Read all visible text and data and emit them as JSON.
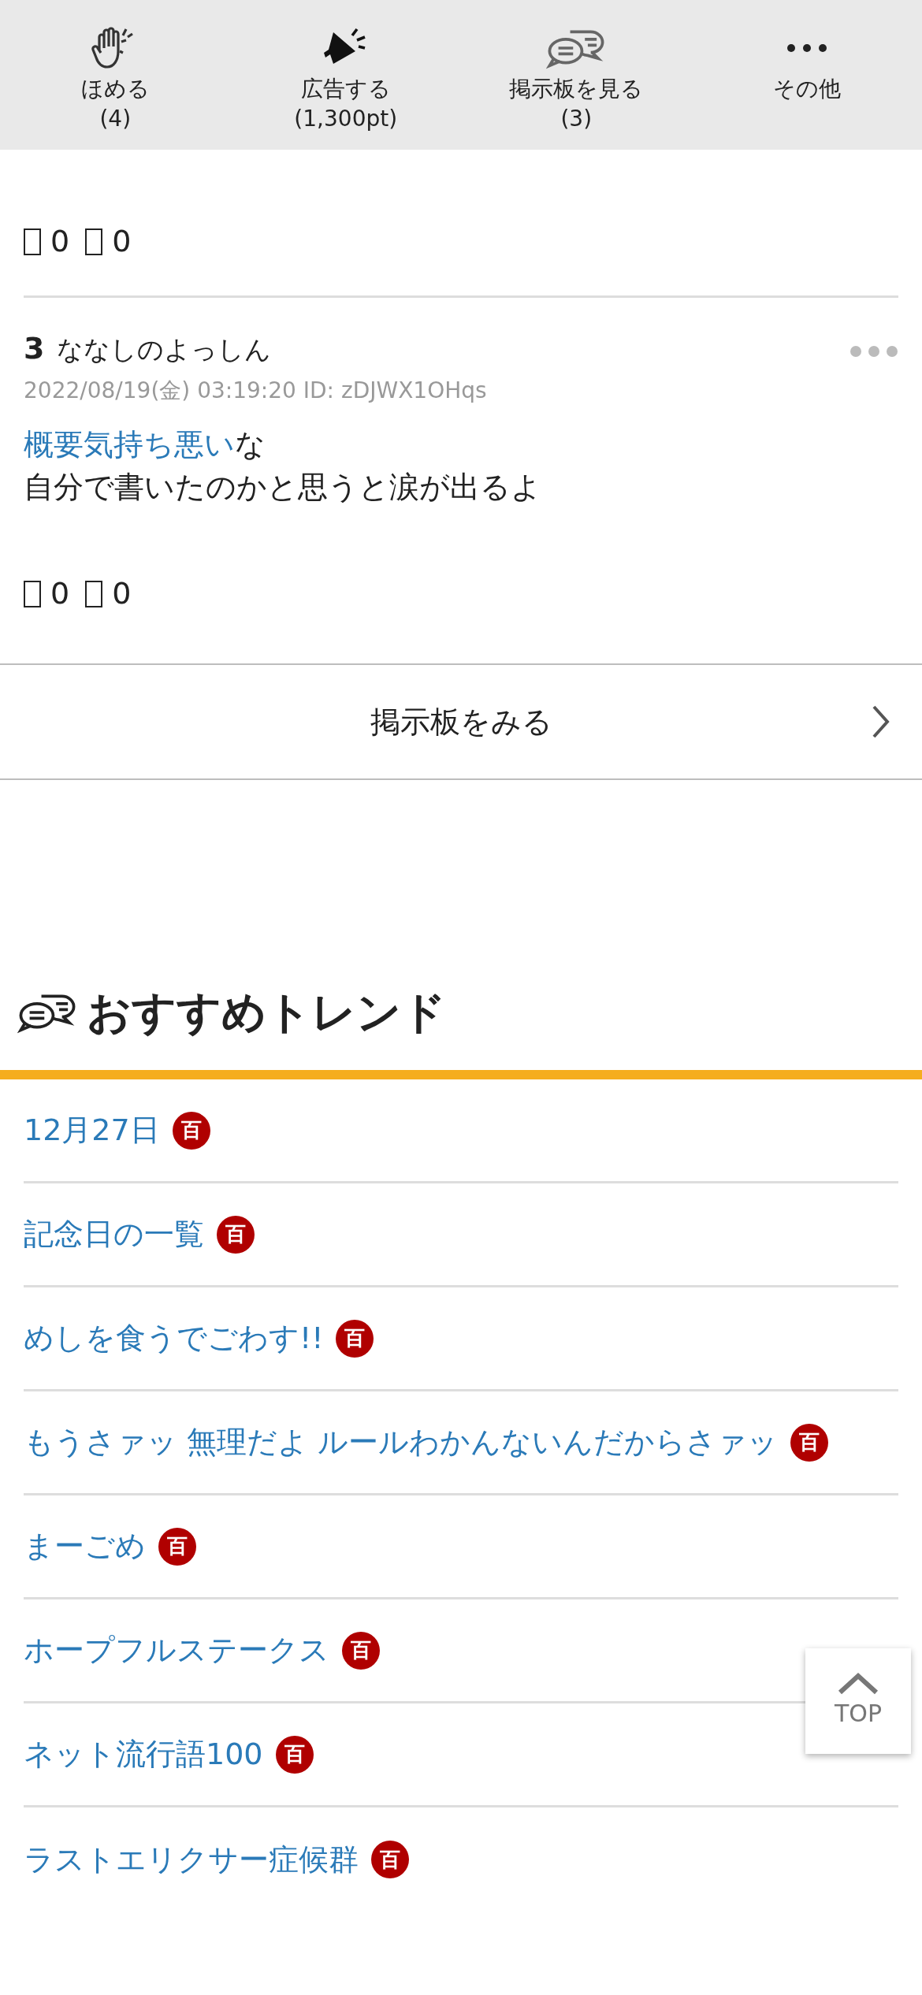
{
  "action_bar": [
    {
      "kind": "clap",
      "label": "ほめる",
      "count": "(4)"
    },
    {
      "kind": "megaphone",
      "label": "広告する",
      "count": "(1,300pt)"
    },
    {
      "kind": "chat",
      "label": "掲示板を見る",
      "count": "(3)"
    },
    {
      "kind": "more",
      "label": "その他"
    }
  ],
  "posts": [
    {
      "reactions": [
        "0",
        "0"
      ]
    },
    {
      "number": "3",
      "name": "ななしのよっしん",
      "meta": "2022/08/19(金) 03:19:20 ID: zDJWX1OHqs",
      "lines": [
        [
          {
            "kind": "link",
            "text": "概要気持ち悪い"
          },
          {
            "kind": "text",
            "text": "な"
          }
        ],
        [
          {
            "kind": "text",
            "text": "自分で書いたのかと思うと涙が出るよ"
          }
        ]
      ],
      "reactions": [
        "0",
        "0"
      ]
    }
  ],
  "board_link": "掲示板をみる",
  "trends": {
    "title": "おすすめトレンド",
    "items": [
      {
        "label": "12月27日",
        "badge": "百"
      },
      {
        "label": "記念日の一覧",
        "badge": "百"
      },
      {
        "label": "めしを食うでごわす!!",
        "badge": "百"
      },
      {
        "label": "もうさァッ 無理だよ ルールわかんないんだからさァッ",
        "badge": "百"
      },
      {
        "label": "まーごめ",
        "badge": "百"
      },
      {
        "label": "ホープフルステークス",
        "badge": "百"
      },
      {
        "label": "ネット流行語100",
        "badge": "百"
      },
      {
        "label": "ラストエリクサー症候群",
        "badge": "百"
      }
    ]
  },
  "top_button": "TOP"
}
